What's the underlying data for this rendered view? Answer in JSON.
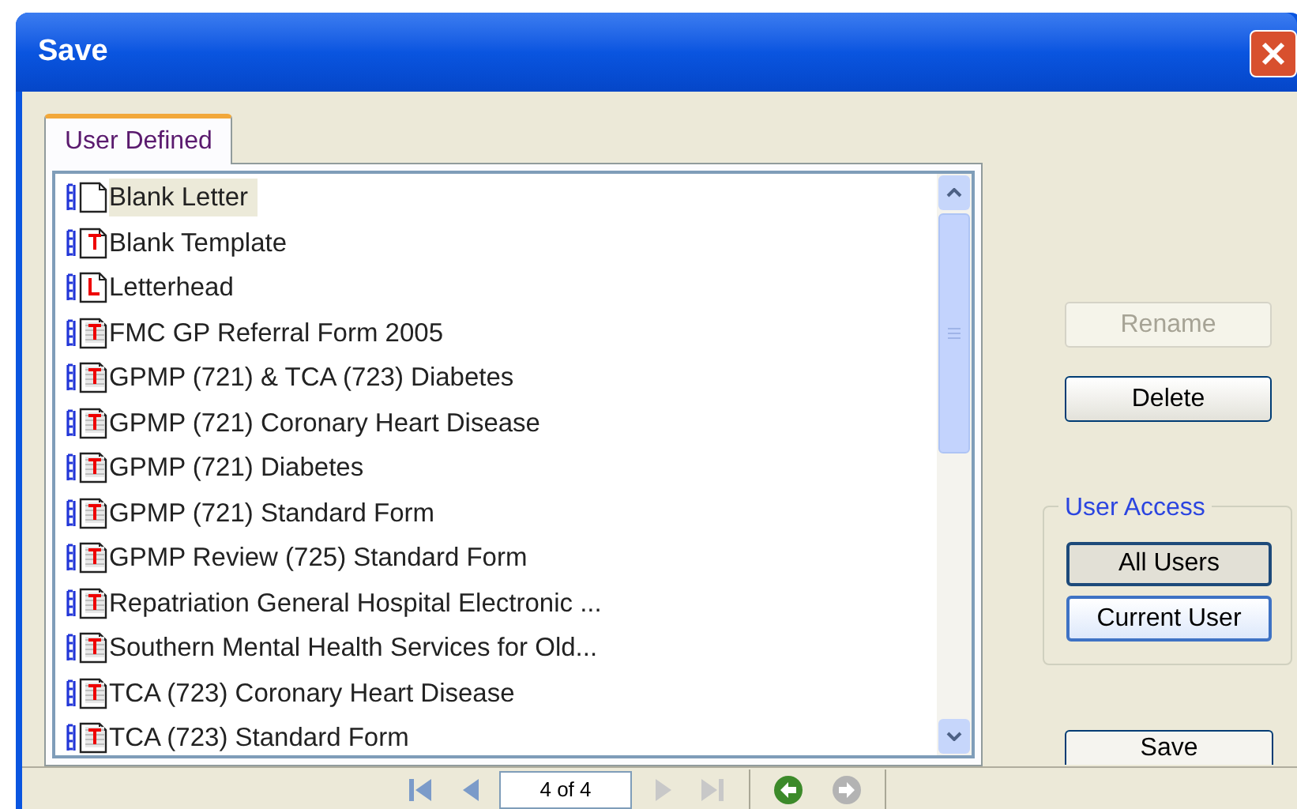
{
  "window": {
    "title": "Save"
  },
  "tabs": [
    {
      "label": "User Defined",
      "selected": true
    }
  ],
  "templates": [
    {
      "name": "Blank Letter",
      "kind": "blank",
      "selected": true
    },
    {
      "name": "Blank Template",
      "kind": "template",
      "selected": false
    },
    {
      "name": "Letterhead",
      "kind": "letterhead",
      "selected": false
    },
    {
      "name": "FMC GP Referral Form 2005",
      "kind": "form",
      "selected": false
    },
    {
      "name": "GPMP (721) & TCA (723) Diabetes",
      "kind": "form",
      "selected": false
    },
    {
      "name": "GPMP (721) Coronary Heart Disease",
      "kind": "form",
      "selected": false
    },
    {
      "name": "GPMP (721) Diabetes",
      "kind": "form",
      "selected": false
    },
    {
      "name": "GPMP (721) Standard Form",
      "kind": "form",
      "selected": false
    },
    {
      "name": "GPMP Review (725) Standard Form",
      "kind": "form",
      "selected": false
    },
    {
      "name": "Repatriation General Hospital Electronic ...",
      "kind": "form",
      "selected": false
    },
    {
      "name": "Southern Mental Health Services for Old...",
      "kind": "form",
      "selected": false
    },
    {
      "name": "TCA (723) Coronary Heart Disease",
      "kind": "form",
      "selected": false
    },
    {
      "name": "TCA (723) Standard Form",
      "kind": "form",
      "selected": false
    }
  ],
  "buttons": [
    {
      "label": "Rename",
      "disabled": true
    },
    {
      "label": "Delete",
      "disabled": false
    }
  ],
  "user_access": {
    "label": "User Access",
    "options": [
      {
        "label": "All Users",
        "selected": true
      },
      {
        "label": "Current User",
        "selected": false
      }
    ]
  },
  "save_button": {
    "label": "Save"
  },
  "pager": {
    "value": "4 of 4"
  }
}
